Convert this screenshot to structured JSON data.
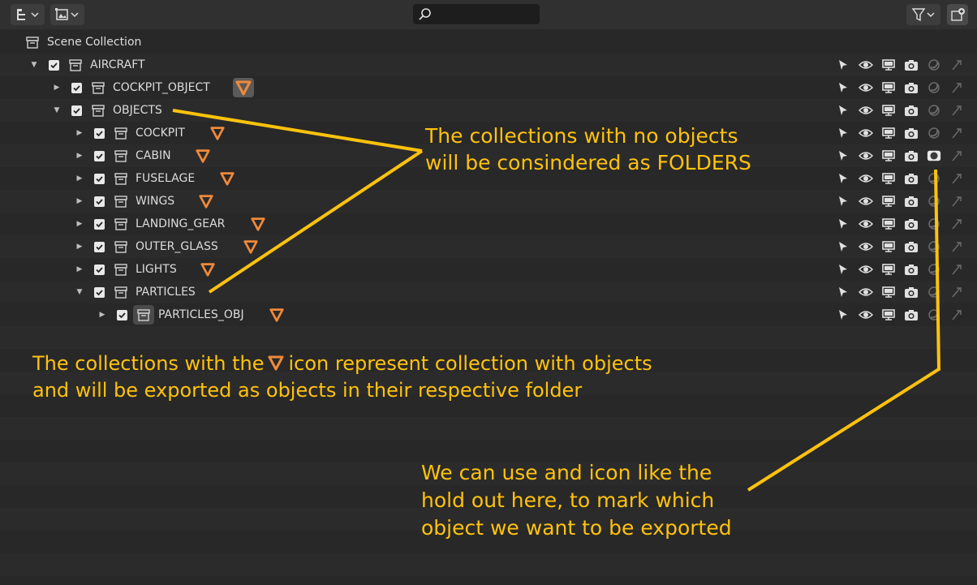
{
  "header": {
    "display_mode_icon": "outliner-display-icon",
    "filter_icon": "filter-funnel-icon",
    "new_collection_icon": "new-collection-icon",
    "search": {
      "placeholder": ""
    }
  },
  "tree": {
    "root_label": "Scene Collection",
    "items": [
      {
        "label": "AIRCRAFT",
        "level": 0,
        "expanded": true,
        "checked": true,
        "marker": false
      },
      {
        "label": "COCKPIT_OBJECT",
        "level": 1,
        "expanded": false,
        "checked": true,
        "marker": true,
        "marker_highlighted": true
      },
      {
        "label": "OBJECTS",
        "level": 1,
        "expanded": true,
        "checked": true,
        "marker": false
      },
      {
        "label": "COCKPIT",
        "level": 2,
        "expanded": false,
        "checked": true,
        "marker": true
      },
      {
        "label": "CABIN",
        "level": 2,
        "expanded": false,
        "checked": true,
        "marker": true,
        "holdout_active": true
      },
      {
        "label": "FUSELAGE",
        "level": 2,
        "expanded": false,
        "checked": true,
        "marker": true
      },
      {
        "label": "WINGS",
        "level": 2,
        "expanded": false,
        "checked": true,
        "marker": true
      },
      {
        "label": "LANDING_GEAR",
        "level": 2,
        "expanded": false,
        "checked": true,
        "marker": true
      },
      {
        "label": "OUTER_GLASS",
        "level": 2,
        "expanded": false,
        "checked": true,
        "marker": true
      },
      {
        "label": "LIGHTS",
        "level": 2,
        "expanded": false,
        "checked": true,
        "marker": true
      },
      {
        "label": "PARTICLES",
        "level": 2,
        "expanded": true,
        "checked": true,
        "marker": false
      },
      {
        "label": "PARTICLES_OBJ",
        "level": 3,
        "expanded": false,
        "checked": true,
        "marker": true,
        "icon_highlighted": true
      }
    ]
  },
  "annotations": {
    "folders_line1": "The collections with no objects",
    "folders_line2": "will be consindered as FOLDERS",
    "objects_line1_a": "The collections with the",
    "objects_line1_b": "icon represent collection with objects",
    "objects_line2": "and will be exported as objects in their respective folder",
    "holdout_line1": "We can use and icon like the",
    "holdout_line2": "hold out here, to mark which",
    "holdout_line3": "object we want to be exported"
  },
  "colors": {
    "annotation": "#ffc20e",
    "marker": "#f0893a",
    "background": "#282828",
    "header": "#303030"
  }
}
